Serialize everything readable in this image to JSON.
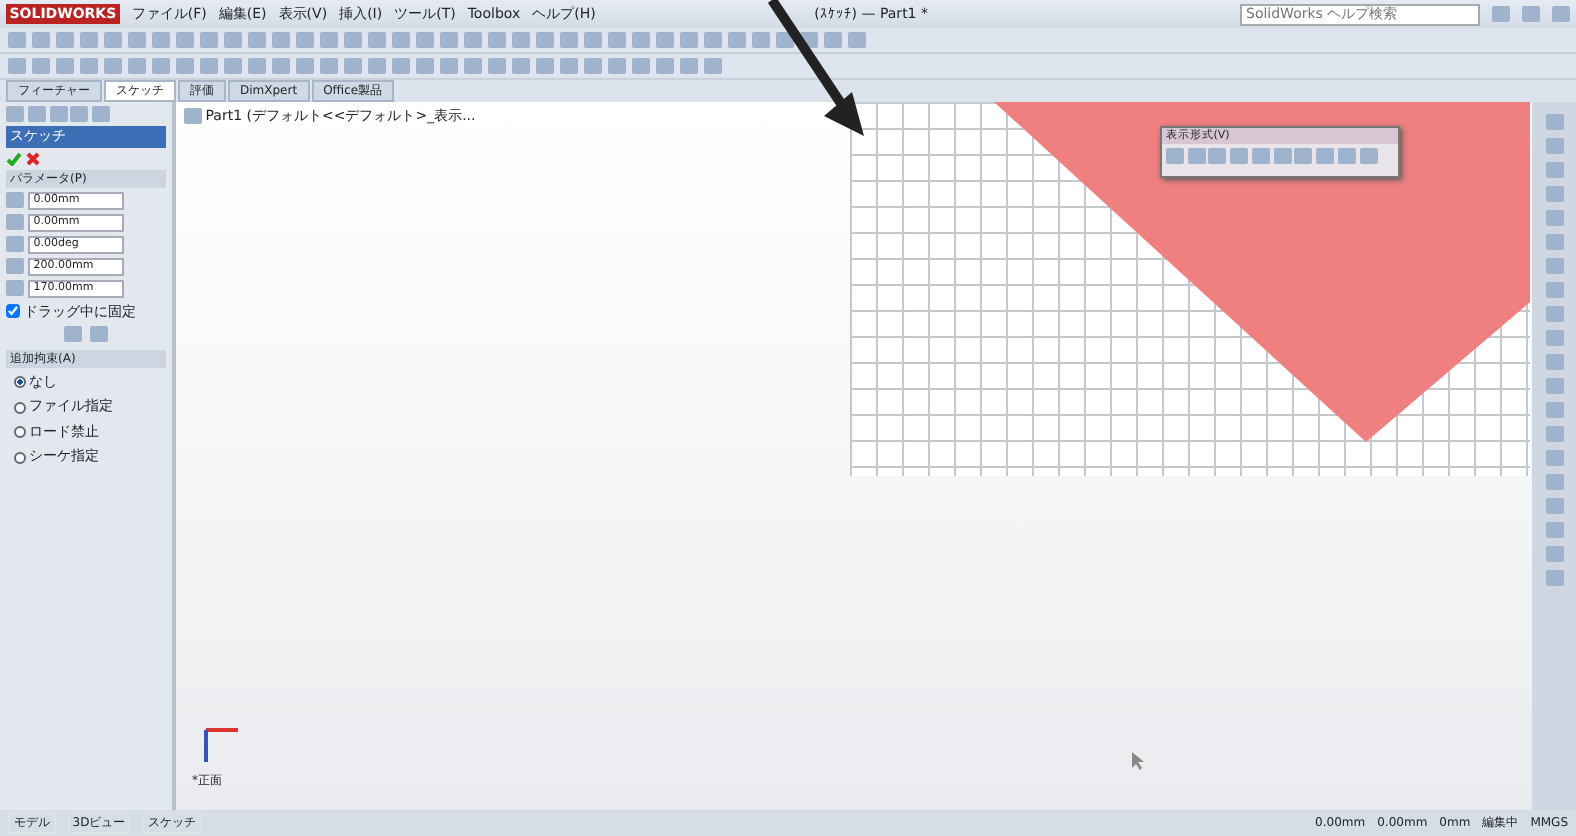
{
  "window": {
    "app": "SOLIDWORKS",
    "title": "(ｽｹｯﾁ) — Part1 *",
    "search_placeholder": "SolidWorks ヘルプ検索"
  },
  "menus": [
    "ファイル(F)",
    "編集(E)",
    "表示(V)",
    "挿入(I)",
    "ツール(T)",
    "Toolbox",
    "ヘルプ(H)"
  ],
  "tabs": [
    {
      "label": "フィーチャー",
      "selected": false
    },
    {
      "label": "スケッチ",
      "selected": true
    },
    {
      "label": "評価",
      "selected": false
    },
    {
      "label": "DimXpert",
      "selected": false
    },
    {
      "label": "Office製品",
      "selected": false
    }
  ],
  "tree": {
    "label": "Part1 (デフォルト<<デフォルト>_表示..."
  },
  "panel": {
    "title": "スケッチ",
    "section": "パラメータ(P)",
    "fields": [
      {
        "value": "0.00mm"
      },
      {
        "value": "0.00mm"
      },
      {
        "value": "0.00deg"
      },
      {
        "value": "200.00mm"
      },
      {
        "value": "170.00mm"
      }
    ],
    "option": {
      "label": "ドラッグ中に固定",
      "checked": true
    },
    "section2": "追加拘束(A)",
    "radios": [
      {
        "label": "なし",
        "selected": true
      },
      {
        "label": "ファイル指定",
        "selected": false
      },
      {
        "label": "ロード禁止",
        "selected": false
      },
      {
        "label": "シーケ指定",
        "selected": false
      }
    ]
  },
  "popup": {
    "title": "表示形式(V)"
  },
  "origin_label": "*正面",
  "status_bar": {
    "left": [
      "モデル",
      "3Dビュー",
      "スケッチ"
    ],
    "right": [
      "0.00mm",
      "0.00mm",
      "0mm",
      "編集中",
      "MMGS"
    ]
  }
}
